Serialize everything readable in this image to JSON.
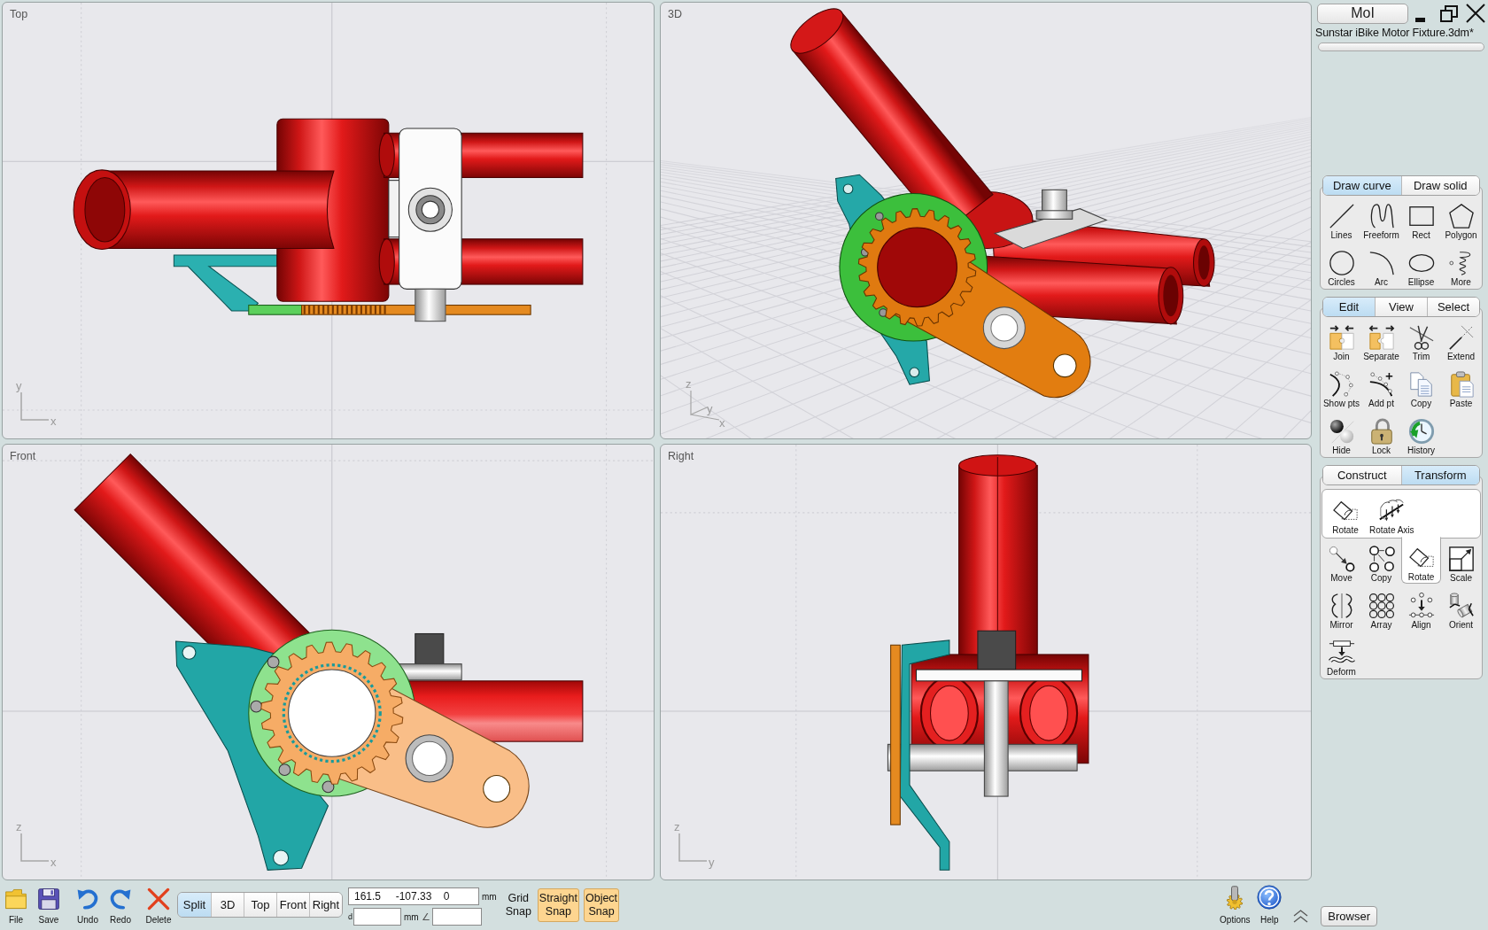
{
  "viewports": [
    {
      "title": "Top",
      "kind": "top",
      "axes": [
        "y",
        "x"
      ]
    },
    {
      "title": "3D",
      "kind": "perspective",
      "axes": [
        "z",
        "y",
        "x"
      ]
    },
    {
      "title": "Front",
      "kind": "front",
      "axes": [
        "z",
        "x"
      ]
    },
    {
      "title": "Right",
      "kind": "right",
      "axes": [
        "z",
        "y"
      ]
    }
  ],
  "sidebar": {
    "app_button": "MoI",
    "file_name": "Sunstar iBike Motor Fixture.3dm*",
    "palettes": [
      {
        "tabs": [
          {
            "label": "Draw curve",
            "selected": true
          },
          {
            "label": "Draw solid",
            "selected": false
          }
        ],
        "tools": [
          {
            "label": "Lines",
            "kind": "lines"
          },
          {
            "label": "Freeform",
            "kind": "freeform"
          },
          {
            "label": "Rect",
            "kind": "rect"
          },
          {
            "label": "Polygon",
            "kind": "polygon"
          },
          {
            "label": "Circles",
            "kind": "circles"
          },
          {
            "label": "Arc",
            "kind": "arc"
          },
          {
            "label": "Ellipse",
            "kind": "ellipse"
          },
          {
            "label": "More",
            "kind": "more"
          }
        ]
      },
      {
        "tabs": [
          {
            "label": "Edit",
            "selected": true
          },
          {
            "label": "View",
            "selected": false
          },
          {
            "label": "Select",
            "selected": false
          }
        ],
        "tools": [
          {
            "label": "Join",
            "kind": "join"
          },
          {
            "label": "Separate",
            "kind": "separate"
          },
          {
            "label": "Trim",
            "kind": "trim"
          },
          {
            "label": "Extend",
            "kind": "extend"
          },
          {
            "label": "Show pts",
            "kind": "showpts"
          },
          {
            "label": "Add pt",
            "kind": "addpt"
          },
          {
            "label": "Copy",
            "kind": "copy"
          },
          {
            "label": "Paste",
            "kind": "paste"
          },
          {
            "label": "Hide",
            "kind": "hide"
          },
          {
            "label": "Lock",
            "kind": "lock"
          },
          {
            "label": "History",
            "kind": "history"
          }
        ]
      },
      {
        "tabs": [
          {
            "label": "Construct",
            "selected": false
          },
          {
            "label": "Transform",
            "selected": true
          }
        ],
        "flyout": [
          {
            "label": "Rotate",
            "kind": "rotate"
          },
          {
            "label": "Rotate Axis",
            "kind": "rotateaxis"
          }
        ],
        "tools": [
          {
            "label": "Move",
            "kind": "move",
            "selected": false
          },
          {
            "label": "Copy",
            "kind": "duplicate",
            "selected": false
          },
          {
            "label": "Rotate",
            "kind": "rotate",
            "selected": true
          },
          {
            "label": "Scale",
            "kind": "scale",
            "selected": false
          },
          {
            "label": "Mirror",
            "kind": "mirror",
            "selected": false
          },
          {
            "label": "Array",
            "kind": "array",
            "selected": false
          },
          {
            "label": "Align",
            "kind": "align",
            "selected": false
          },
          {
            "label": "Orient",
            "kind": "orient",
            "selected": false
          },
          {
            "label": "Deform",
            "kind": "deform",
            "selected": false
          }
        ]
      }
    ]
  },
  "toolbar": {
    "buttons": [
      {
        "label": "File",
        "kind": "file"
      },
      {
        "label": "Save",
        "kind": "save"
      },
      {
        "label": "Undo",
        "kind": "undo"
      },
      {
        "label": "Redo",
        "kind": "redo"
      },
      {
        "label": "Delete",
        "kind": "delete"
      }
    ],
    "view_tabs": [
      {
        "label": "Split",
        "selected": true
      },
      {
        "label": "3D",
        "selected": false
      },
      {
        "label": "Top",
        "selected": false
      },
      {
        "label": "Front",
        "selected": false
      },
      {
        "label": "Right",
        "selected": false
      }
    ],
    "coordinates": {
      "value": "161.5     -107.33    0",
      "unit": "mm"
    },
    "distance": {
      "label": "d",
      "unit": "mm"
    },
    "angle": {
      "label": "∠"
    },
    "snaps": [
      {
        "label": "Grid Snap",
        "on": false
      },
      {
        "label": "Straight Snap",
        "on": true
      },
      {
        "label": "Object Snap",
        "on": true
      }
    ],
    "help_buttons": [
      {
        "label": "Options",
        "kind": "options"
      },
      {
        "label": "Help",
        "kind": "help"
      }
    ],
    "browser_button": "Browser"
  }
}
